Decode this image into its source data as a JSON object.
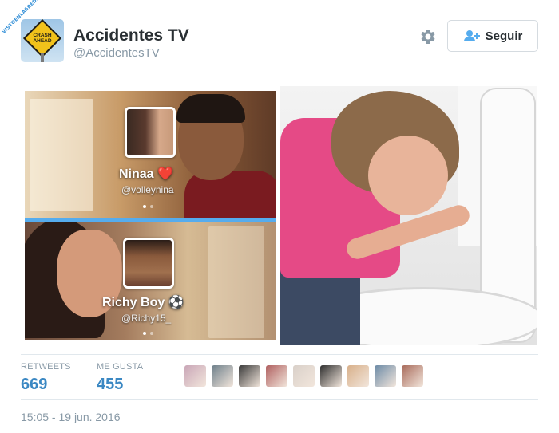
{
  "watermark": "VISTOENLASREDES",
  "account": {
    "name": "Accidentes TV",
    "handle": "@AccidentesTV",
    "avatar_text": "CRASH\nAHEAD"
  },
  "follow_button": {
    "label": "Seguir"
  },
  "media": {
    "panel1": {
      "name": "Ninaa ❤️",
      "handle": "@volleynina"
    },
    "panel2": {
      "name": "Richy Boy ⚽",
      "handle": "@Richy15_"
    }
  },
  "stats": {
    "retweets_label": "RETWEETS",
    "retweets_value": "669",
    "likes_label": "ME GUSTA",
    "likes_value": "455"
  },
  "liker_colors": [
    "#c9a6b7",
    "#6d7f8a",
    "#3a3a3a",
    "#b06060",
    "#d9d0c9",
    "#2f2f2f",
    "#d8b08a",
    "#6b8aa6",
    "#a86a5a"
  ],
  "timestamp": "15:05 - 19 jun. 2016",
  "colors": {
    "accent": "#3b88c3",
    "muted": "#8899a6",
    "divider": "#55acee"
  }
}
